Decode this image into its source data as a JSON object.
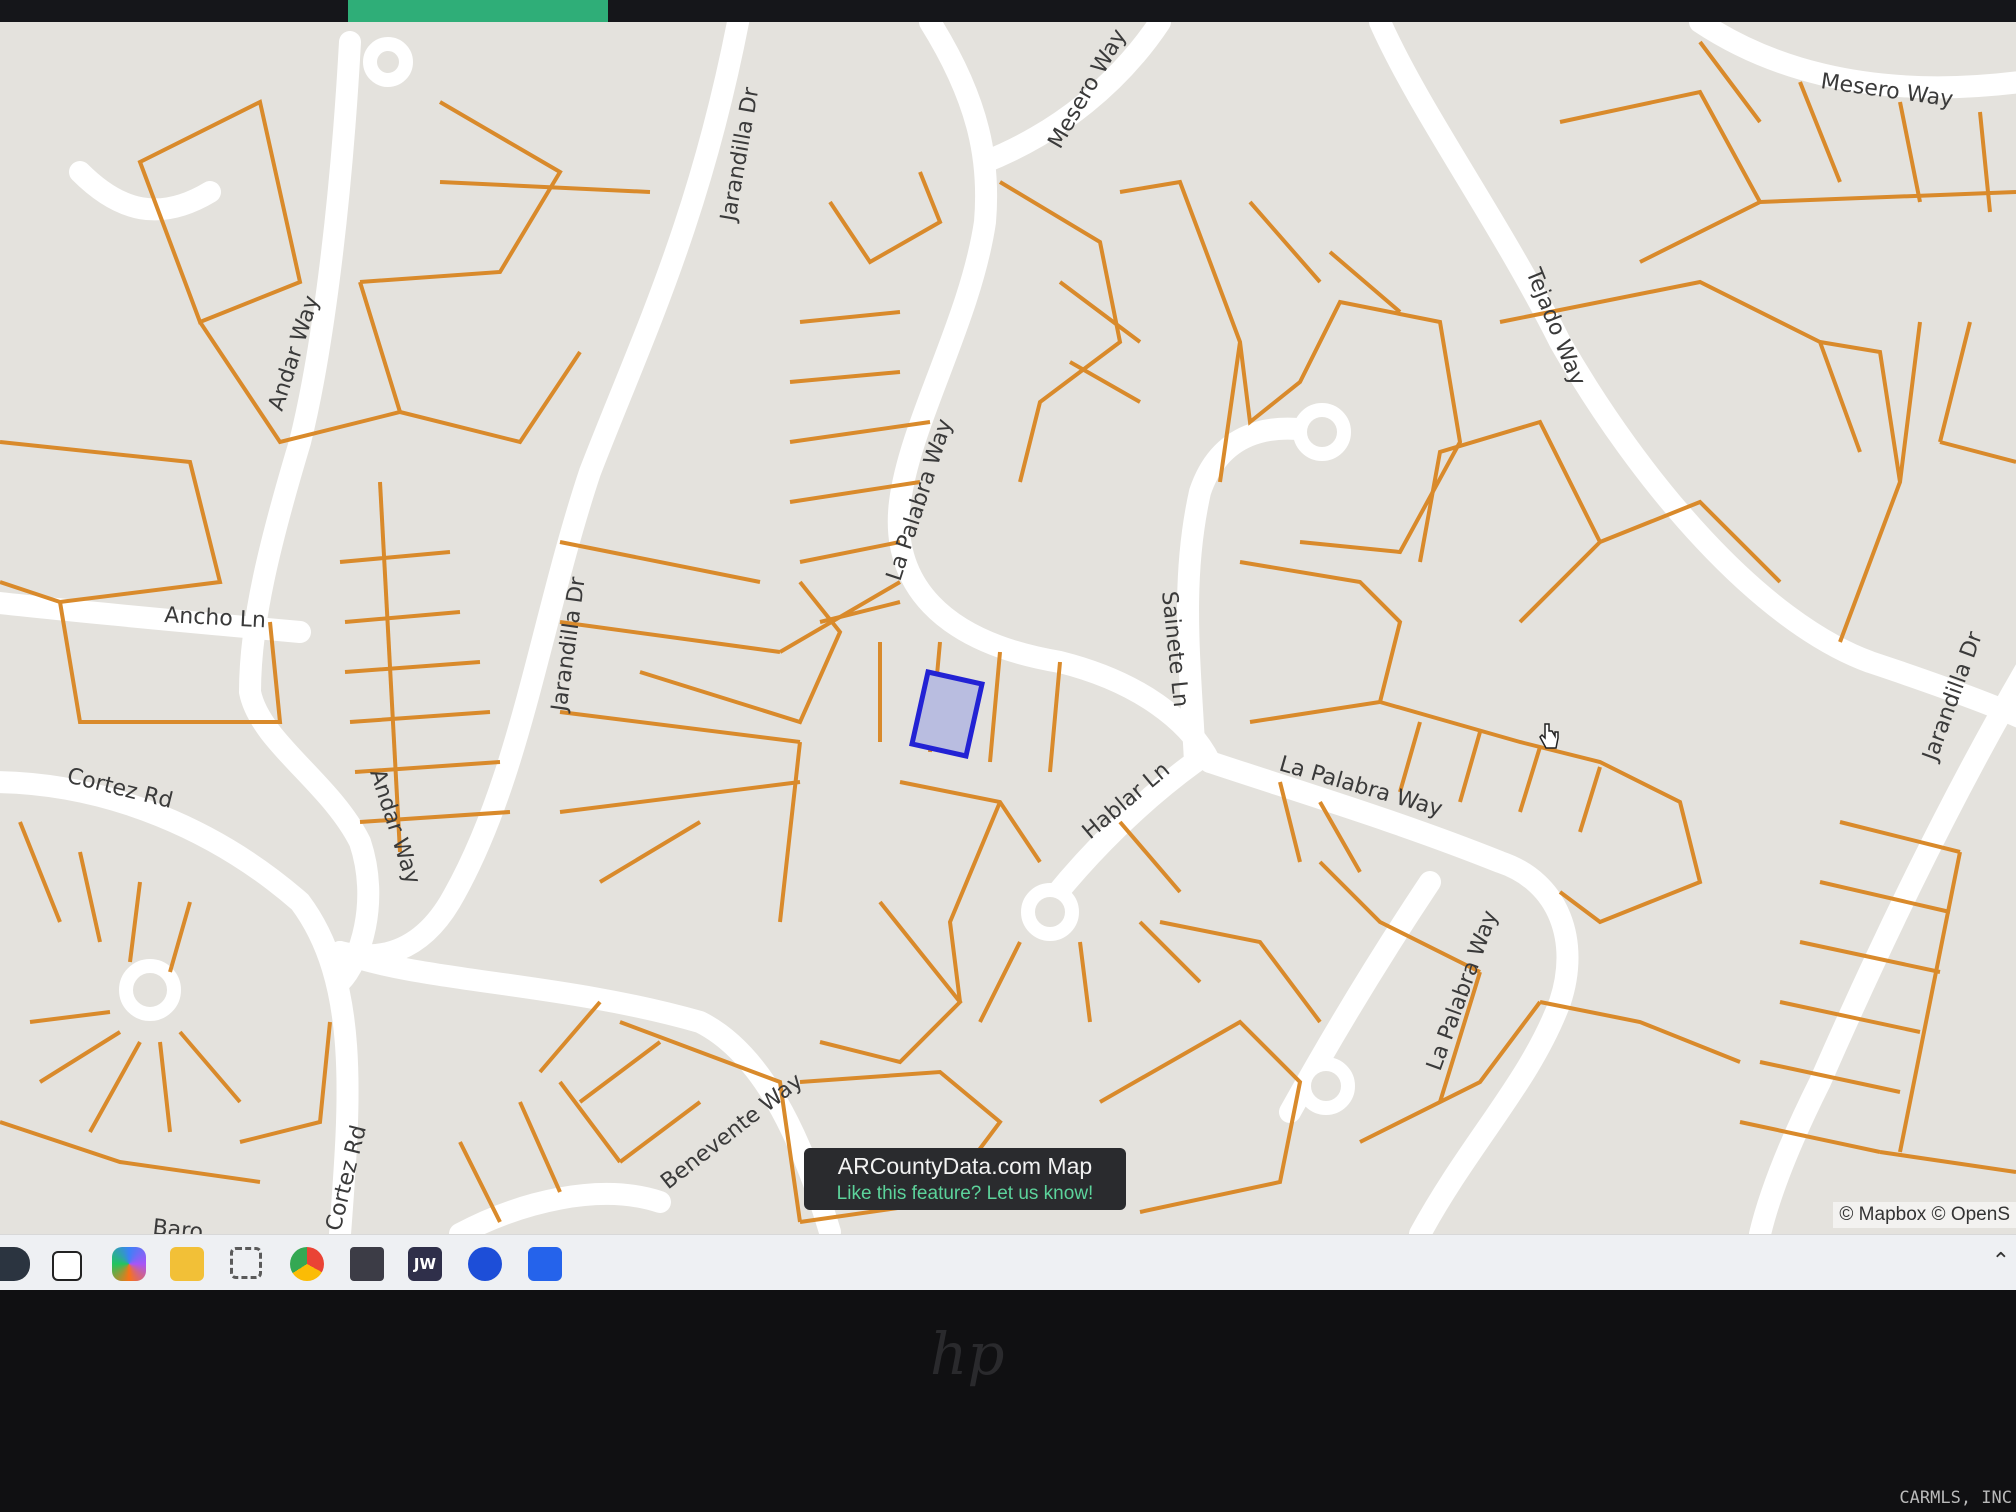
{
  "tooltip": {
    "title": "ARCountyData.com Map",
    "link": "Like this feature? Let us know!"
  },
  "map": {
    "attribution": "© Mapbox © OpenS",
    "colors": {
      "parcel_line": "#d98a2b",
      "road": "#ffffff",
      "land": "#e4e2dd",
      "selected_fill": "#b9bde0",
      "selected_stroke": "#2222d4"
    },
    "streets": [
      "Jarandilla Dr",
      "Mesero Way",
      "Mesero Way",
      "Andar Way",
      "Ancho Ln",
      "Jarandilla Dr",
      "Cortez Rd",
      "Andar Way",
      "La Palabra Way",
      "Sainete Ln",
      "Tejado Way",
      "Jarandilla Dr",
      "Hablar Ln",
      "La Palabra Way",
      "La Palabra Way",
      "Benevente Way",
      "Cortez Rd",
      "Baro"
    ]
  },
  "taskbar": {
    "icons": [
      "start-icon",
      "files-icon",
      "copilot-icon",
      "file-explorer-icon",
      "snipping-tool-icon",
      "chrome-icon",
      "printer-icon",
      "jw-icon",
      "malwarebytes-icon",
      "calculator-icon"
    ],
    "jw_label": "JW"
  },
  "device": {
    "watermark": "CARMLS, INC"
  }
}
